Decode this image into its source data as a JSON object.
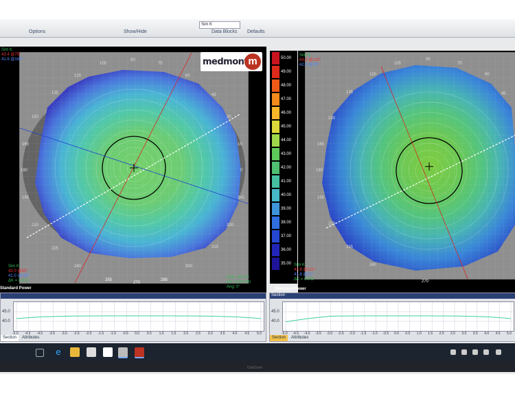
{
  "toolbar": {
    "labels": [
      "Options",
      "Show/Hide",
      "Data Blocks",
      "Defaults"
    ],
    "dropdown": "Sim K"
  },
  "left_map": {
    "top_label_1": "Sim K",
    "top_values": [
      "43.4 @75°",
      "41.6 @165°"
    ],
    "degree_labels": [
      "105",
      "90",
      "75",
      "120",
      "60",
      "135",
      "45",
      "150",
      "30",
      "165",
      "15",
      "180",
      "0",
      "195",
      "345",
      "210",
      "330",
      "225",
      "315",
      "240",
      "300",
      "255",
      "270",
      "285"
    ],
    "sim_k_label": "Sim K",
    "sim_k_values": [
      "42.0 @90°",
      "41.0 @180°",
      "ΔK = 0.4 D"
    ],
    "readout": [
      "Pow: 42.0 D",
      "Dis: 0.00 mm",
      "Ang: 0°"
    ],
    "bottom_ticks": [
      "255",
      "270",
      "285"
    ],
    "footer": "Standard Power"
  },
  "right_map": {
    "top_label_1": "Sim K",
    "top_values": [
      "43.3 @119°",
      "42.8 @29°"
    ],
    "degree_labels": [
      "105",
      "90",
      "75",
      "120",
      "60",
      "135",
      "45",
      "150",
      "30",
      "165",
      "15",
      "180",
      "0",
      "195",
      "345",
      "210",
      "330",
      "225",
      "315",
      "240",
      "300",
      "255",
      "270",
      "285"
    ],
    "sim_k_label": "Sim K",
    "sim_k_values": [
      "42.9 @121°",
      "41.8 @31°",
      "ΔK = 0.9 D"
    ],
    "bottom_ticks": [
      "270"
    ],
    "footer": "Standard Power"
  },
  "logo": {
    "text": "medmont",
    "mark": "m"
  },
  "color_scale": {
    "values": [
      "50.00",
      "49.00",
      "48.00",
      "47.00",
      "46.00",
      "45.00",
      "44.00",
      "43.00",
      "42.00",
      "41.00",
      "40.00",
      "39.00",
      "38.00",
      "37.00",
      "36.00",
      "35.00"
    ],
    "colors": [
      "#c8141e",
      "#dd2a1a",
      "#ee5a18",
      "#f58a1c",
      "#f7b62a",
      "#dcd83a",
      "#9ed84a",
      "#5fc95a",
      "#4fbf72",
      "#45bfa0",
      "#46b8c8",
      "#3e94d8",
      "#2f6fe0",
      "#2448d0",
      "#2226b8",
      "#1e1498"
    ]
  },
  "left_section": {
    "ylabels": [
      "45.0",
      "40.0"
    ],
    "xticks": [
      "-5.0",
      "-4.5",
      "-4.0",
      "-3.5",
      "-3.0",
      "-2.5",
      "-2.0",
      "-1.5",
      "-1.0",
      "-0.5",
      "0.0",
      "0.5",
      "1.0",
      "1.5",
      "2.0",
      "2.5",
      "3.0",
      "3.5",
      "4.0",
      "4.5",
      "5.0"
    ],
    "tabs": [
      "Section",
      "Attributes"
    ]
  },
  "right_section": {
    "title": "Section",
    "ylabels": [
      "45.0",
      "40.0"
    ],
    "xticks": [
      "-5.0",
      "-4.5",
      "-4.0",
      "-3.5",
      "-3.0",
      "-2.5",
      "-2.0",
      "-1.5",
      "-1.0",
      "-0.5",
      "0.0",
      "0.5",
      "1.0",
      "1.5",
      "2.0",
      "2.5",
      "3.0",
      "3.5",
      "4.0",
      "4.5",
      "5.0"
    ],
    "tabs": [
      "Section",
      "Attributes"
    ]
  },
  "brand": "OptiZoom"
}
